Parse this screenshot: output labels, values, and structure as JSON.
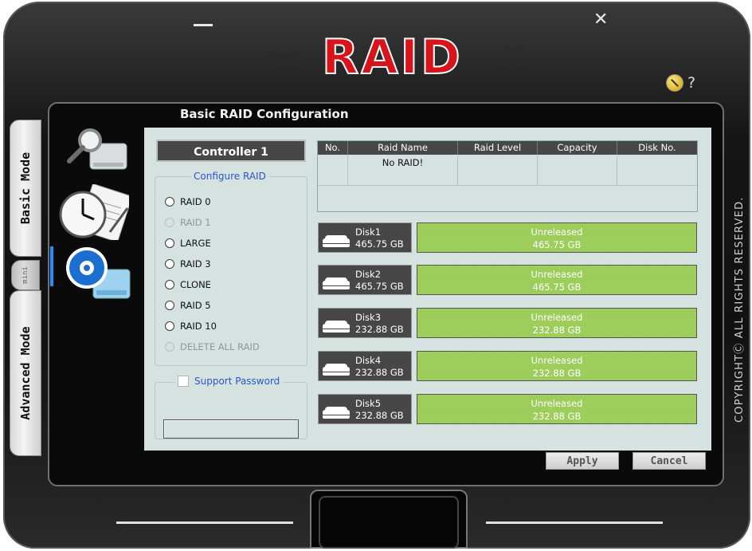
{
  "app": {
    "logo": "RAID",
    "copyright": "COPYRIGHTⒸ ALL RIGHTS RESERVED."
  },
  "window_controls": {
    "minimize": "—",
    "close": "✕",
    "help": "?"
  },
  "side_tabs": {
    "basic": "Basic Mode",
    "mini": "mini",
    "advanced": "Advanced Mode"
  },
  "panel": {
    "title": "Basic RAID Configuration"
  },
  "nav": [
    "disk-info-icon",
    "schedule-icon",
    "raid-config-icon"
  ],
  "controller": {
    "label": "Controller 1"
  },
  "configure_raid": {
    "legend": "Configure RAID",
    "options": [
      {
        "label": "RAID 0",
        "enabled": true
      },
      {
        "label": "RAID 1",
        "enabled": false
      },
      {
        "label": "LARGE",
        "enabled": true
      },
      {
        "label": "RAID 3",
        "enabled": true
      },
      {
        "label": "CLONE",
        "enabled": true
      },
      {
        "label": "RAID 5",
        "enabled": true
      },
      {
        "label": "RAID 10",
        "enabled": true
      },
      {
        "label": "DELETE ALL RAID",
        "enabled": false
      }
    ]
  },
  "password": {
    "label": "Support Password",
    "checked": false,
    "value": ""
  },
  "raid_table": {
    "columns": [
      "No.",
      "Raid Name",
      "Raid Level",
      "Capacity",
      "Disk No."
    ],
    "rows": [
      [
        "",
        "No RAID!",
        "",
        "",
        ""
      ]
    ]
  },
  "disks": [
    {
      "name": "Disk1",
      "size": "465.75 GB",
      "status": "Unreleased",
      "status_size": "465.75 GB"
    },
    {
      "name": "Disk2",
      "size": "465.75 GB",
      "status": "Unreleased",
      "status_size": "465.75 GB"
    },
    {
      "name": "Disk3",
      "size": "232.88 GB",
      "status": "Unreleased",
      "status_size": "232.88 GB"
    },
    {
      "name": "Disk4",
      "size": "232.88 GB",
      "status": "Unreleased",
      "status_size": "232.88 GB"
    },
    {
      "name": "Disk5",
      "size": "232.88 GB",
      "status": "Unreleased",
      "status_size": "232.88 GB"
    }
  ],
  "buttons": {
    "apply": "Apply",
    "cancel": "Cancel"
  },
  "colors": {
    "logo_red": "#d8141a",
    "status_green": "#9ccc5a",
    "content_bg": "#d6e2e0",
    "legend_blue": "#2a55c8",
    "active_nav": "#1e90ff"
  }
}
